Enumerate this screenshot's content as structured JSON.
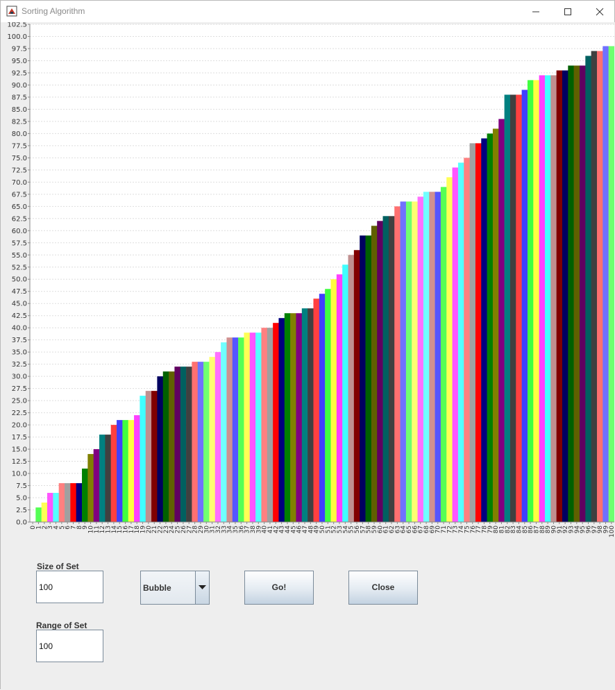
{
  "window": {
    "title": "Sorting Algorithm",
    "icons": {
      "app": "java-app-icon",
      "minimize": "minimize-icon",
      "maximize": "maximize-icon",
      "close": "close-icon"
    }
  },
  "chart_data": {
    "type": "bar",
    "ylim": [
      0,
      102.5
    ],
    "y_ticks": [
      "0.0",
      "2.5",
      "5.0",
      "7.5",
      "10.0",
      "12.5",
      "15.0",
      "17.5",
      "20.0",
      "22.5",
      "25.0",
      "27.5",
      "30.0",
      "32.5",
      "35.0",
      "37.5",
      "40.0",
      "42.5",
      "45.0",
      "47.5",
      "50.0",
      "52.5",
      "55.0",
      "57.5",
      "60.0",
      "62.5",
      "65.0",
      "67.5",
      "70.0",
      "72.5",
      "75.0",
      "77.5",
      "80.0",
      "82.5",
      "85.0",
      "87.5",
      "90.0",
      "92.5",
      "95.0",
      "97.5",
      "100.0",
      "102.5"
    ],
    "grid": true,
    "categories": [
      "0",
      "1",
      "2",
      "3",
      "4",
      "5",
      "6",
      "7",
      "8",
      "9",
      "10",
      "11",
      "12",
      "13",
      "14",
      "15",
      "16",
      "17",
      "18",
      "19",
      "20",
      "21",
      "22",
      "23",
      "24",
      "25",
      "26",
      "27",
      "28",
      "29",
      "30",
      "31",
      "32",
      "33",
      "34",
      "35",
      "36",
      "37",
      "38",
      "39",
      "40",
      "41",
      "42",
      "43",
      "44",
      "45",
      "46",
      "47",
      "48",
      "49",
      "50",
      "51",
      "52",
      "53",
      "54",
      "55",
      "56",
      "57",
      "58",
      "59",
      "60",
      "61",
      "62",
      "63",
      "64",
      "65",
      "66",
      "67",
      "68",
      "69",
      "70",
      "71",
      "72",
      "73",
      "74",
      "75",
      "76",
      "77",
      "78",
      "79",
      "80",
      "81",
      "82",
      "83",
      "84",
      "85",
      "86",
      "87",
      "88",
      "89",
      "90",
      "91",
      "92",
      "93",
      "94",
      "95",
      "96",
      "97",
      "98",
      "99",
      "100"
    ],
    "values": [
      0,
      3,
      4,
      6,
      6,
      8,
      8,
      8,
      8,
      11,
      14,
      15,
      18,
      18,
      20,
      21,
      21,
      21,
      22,
      26,
      27,
      27,
      30,
      31,
      31,
      32,
      32,
      32,
      33,
      33,
      33,
      34,
      35,
      37,
      38,
      38,
      38,
      39,
      39,
      39,
      40,
      40,
      41,
      42,
      43,
      43,
      43,
      44,
      44,
      46,
      47,
      48,
      50,
      51,
      53,
      55,
      56,
      59,
      59,
      61,
      62,
      63,
      63,
      65,
      66,
      66,
      66,
      67,
      68,
      68,
      68,
      69,
      71,
      73,
      74,
      75,
      78,
      78,
      79,
      80,
      81,
      83,
      88,
      88,
      88,
      89,
      91,
      91,
      92,
      92,
      92,
      93,
      93,
      94,
      94,
      94,
      96,
      97,
      97,
      98,
      98
    ],
    "colors": [
      "#5555ff",
      "#55ff55",
      "#ffff55",
      "#ff55ff",
      "#55ffff",
      "#ff8080",
      "#a0a0a0",
      "#ff0000",
      "#000080",
      "#008000",
      "#808000",
      "#800080",
      "#008080",
      "#404040",
      "#ff4040",
      "#4040ff",
      "#40ff40",
      "#ffff40",
      "#ff40ff",
      "#40ffff",
      "#c09090",
      "#800000",
      "#000060",
      "#006000",
      "#606000",
      "#600060",
      "#006060",
      "#404040",
      "#ff7070",
      "#7070ff",
      "#70ff70",
      "#ffff70",
      "#ff70ff",
      "#70ffff",
      "#d09090"
    ]
  },
  "controls": {
    "size_label": "Size of Set",
    "size_value": "100",
    "range_label": "Range of Set",
    "range_value": "100",
    "algorithm": "Bubble",
    "dropdown_icon": "triangle-down-icon",
    "go_label": "Go!",
    "close_label": "Close"
  }
}
